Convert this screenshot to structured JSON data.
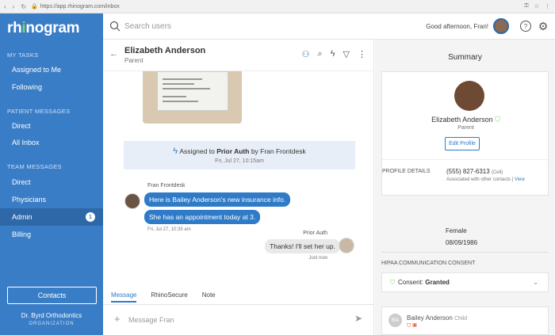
{
  "browser": {
    "url": "https://app.rhinogram.com/inbox"
  },
  "sidebar": {
    "logo_main": "rh",
    "logo_i": "i",
    "logo_rest": "nogram",
    "sections": {
      "my_tasks": "MY TASKS",
      "patient_messages": "PATIENT MESSAGES",
      "team_messages": "TEAM MESSAGES"
    },
    "items": [
      {
        "label": "Assigned to Me"
      },
      {
        "label": "Following"
      },
      {
        "label": "Direct"
      },
      {
        "label": "All Inbox"
      },
      {
        "label": "Direct"
      },
      {
        "label": "Physicians"
      },
      {
        "label": "Admin",
        "badge": "1"
      },
      {
        "label": "Billing"
      }
    ],
    "contacts_button": "Contacts",
    "org_name": "Dr. Byrd Orthodontics",
    "org_label": "ORGANIZATION"
  },
  "topbar": {
    "search_placeholder": "Search users",
    "greeting": "Good afternoon, Fran!"
  },
  "conversation": {
    "name": "Elizabeth Anderson",
    "role": "Parent",
    "assigned_prefix": "Assigned to",
    "assigned_group": "Prior Auth",
    "assigned_by": "by Fran Frontdesk",
    "assigned_time": "Fri, Jul 27, 10:15am",
    "sender": "Fran Frontdesk",
    "msg1": "Here is Bailey Anderson's new insurance info.",
    "msg2": "She has an appointment today at 3.",
    "time1": "Fri, Jul 27, 10:35 am",
    "reply_sender": "Prior Auth",
    "reply": "Thanks! I'll set her up.",
    "reply_time": "Just now",
    "tabs": [
      "Message",
      "RhinoSecure",
      "Note"
    ],
    "composer_placeholder": "Message Fran"
  },
  "summary": {
    "title": "Summary",
    "name": "Elizabeth Anderson",
    "role": "Parent",
    "edit_button": "Edit Profile",
    "details_label": "PROFILE DETAILS",
    "phone": "(555) 827-6313",
    "phone_type": "(Cell)",
    "assoc": "Associated with other contacts |",
    "view": "View",
    "gender": "Female",
    "dob": "08/09/1986",
    "consent_label": "HIPAA COMMUNICATION CONSENT",
    "consent_prefix": "Consent:",
    "consent_value": "Granted",
    "related_initials": "BA",
    "related_name": "Bailey Anderson",
    "related_role": "Child"
  },
  "colors": {
    "brand": "#3a7dc7",
    "bubble": "#2f7bc7",
    "accent_green": "#7fd36b"
  }
}
